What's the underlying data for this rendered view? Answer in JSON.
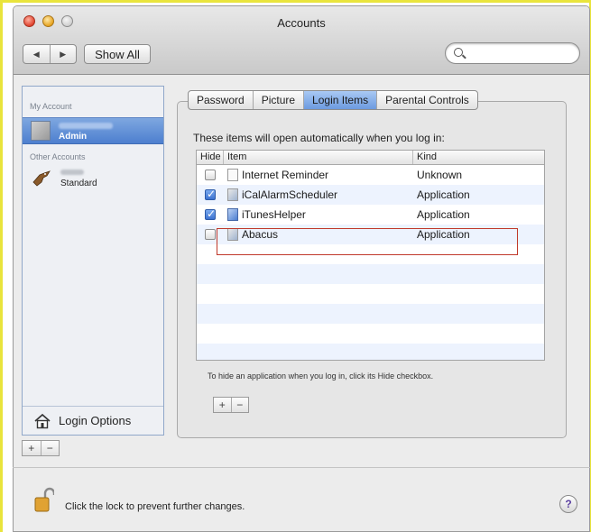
{
  "window": {
    "title": "Accounts"
  },
  "toolbar": {
    "back_label": "◀",
    "forward_label": "▶",
    "show_all_label": "Show All",
    "search_placeholder": ""
  },
  "sidebar": {
    "my_account_header": "My Account",
    "current_user_role": "Admin",
    "other_accounts_header": "Other Accounts",
    "other_user_role": "Standard",
    "login_options_label": "Login Options",
    "add_label": "+",
    "remove_label": "−"
  },
  "tabs": [
    {
      "label": "Password",
      "active": false
    },
    {
      "label": "Picture",
      "active": false
    },
    {
      "label": "Login Items",
      "active": true
    },
    {
      "label": "Parental Controls",
      "active": false
    }
  ],
  "login_items": {
    "instruction": "These items will open automatically when you log in:",
    "columns": {
      "hide": "Hide",
      "item": "Item",
      "kind": "Kind"
    },
    "rows": [
      {
        "name": "Internet Reminder",
        "kind": "Unknown",
        "hide": false,
        "icon": "document-icon"
      },
      {
        "name": "iCalAlarmScheduler",
        "kind": "Application",
        "hide": true,
        "icon": "application-icon"
      },
      {
        "name": "iTunesHelper",
        "kind": "Application",
        "hide": true,
        "icon": "music-app-icon"
      },
      {
        "name": "Abacus",
        "kind": "Application",
        "hide": false,
        "icon": "application-icon"
      }
    ],
    "hint": "To hide an application when you log in, click its Hide checkbox.",
    "add_label": "+",
    "remove_label": "−"
  },
  "footer": {
    "lock_text": "Click the lock to prevent further changes.",
    "help_label": "?"
  },
  "colors": {
    "selection_blue": "#4d7fcf",
    "active_tab": "#6c9ae0",
    "highlight_red": "#c0392b",
    "annotation_yellow": "#e9e43c"
  }
}
